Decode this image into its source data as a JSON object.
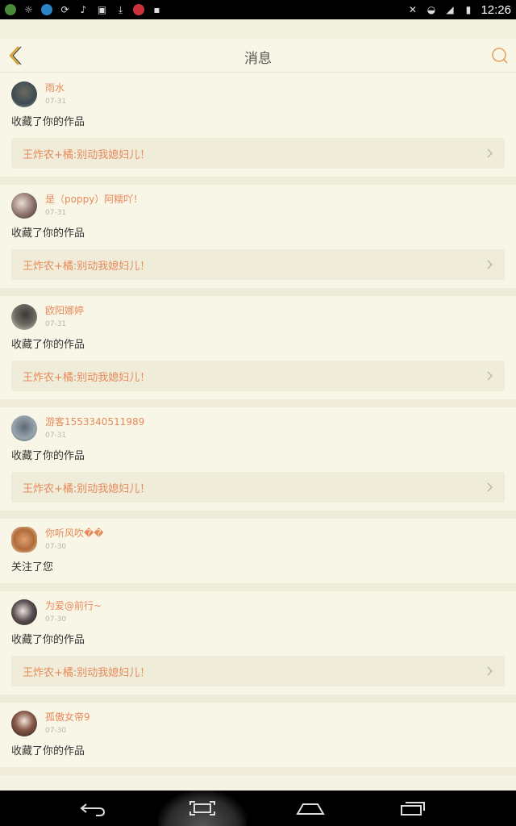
{
  "status_bar": {
    "time": "12:26"
  },
  "header": {
    "title": "消息"
  },
  "messages": [
    {
      "name": "雨水",
      "date": "07-31",
      "action": "收藏了你的作品",
      "work_title": "王炸农+橘:别动我媳妇儿！"
    },
    {
      "name": "是（poppy）阿糯吖！",
      "date": "07-31",
      "action": "收藏了你的作品",
      "work_title": "王炸农+橘:别动我媳妇儿！"
    },
    {
      "name": "欧阳娜婷",
      "date": "07-31",
      "action": "收藏了你的作品",
      "work_title": "王炸农+橘:别动我媳妇儿！"
    },
    {
      "name": "游客1553340511989",
      "date": "07-31",
      "action": "收藏了你的作品",
      "work_title": "王炸农+橘:别动我媳妇儿！"
    },
    {
      "name": "你听风吹��",
      "date": "07-30",
      "action": "关注了您"
    },
    {
      "name": "为爱@前行~",
      "date": "07-30",
      "action": "收藏了你的作品",
      "work_title": "王炸农+橘:别动我媳妇儿！"
    },
    {
      "name": "孤傲女帝9",
      "date": "07-30",
      "action": "收藏了你的作品"
    }
  ],
  "colors": {
    "accent": "#e8895a",
    "background": "#f8f7e7",
    "link_bg": "#efedda"
  }
}
